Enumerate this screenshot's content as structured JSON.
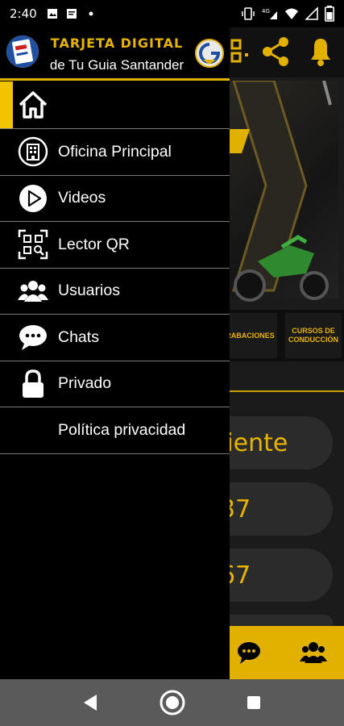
{
  "status_bar": {
    "time": "2:40",
    "network_label": "4G"
  },
  "background_app": {
    "categories": [
      "GRABACIONES",
      "CURSOS DE CONDUCCIÓN"
    ],
    "pills": [
      "liente",
      "37",
      "67"
    ]
  },
  "drawer": {
    "header": {
      "title": "TARJETA DIGITAL",
      "subtitle": "de Tu Guia Santander"
    },
    "items": [
      {
        "label": "",
        "icon": "home-icon",
        "active": true
      },
      {
        "label": "Oficina Principal",
        "icon": "building-icon"
      },
      {
        "label": "Videos",
        "icon": "play-icon"
      },
      {
        "label": "Lector QR",
        "icon": "qr-scan-icon"
      },
      {
        "label": "Usuarios",
        "icon": "users-icon"
      },
      {
        "label": "Chats",
        "icon": "chat-icon"
      },
      {
        "label": "Privado",
        "icon": "lock-icon"
      },
      {
        "label": "Política privacidad",
        "icon": ""
      }
    ]
  },
  "colors": {
    "accent": "#e2b100",
    "drawer_bg": "#000000",
    "nav_bar": "#5a5a5a"
  }
}
